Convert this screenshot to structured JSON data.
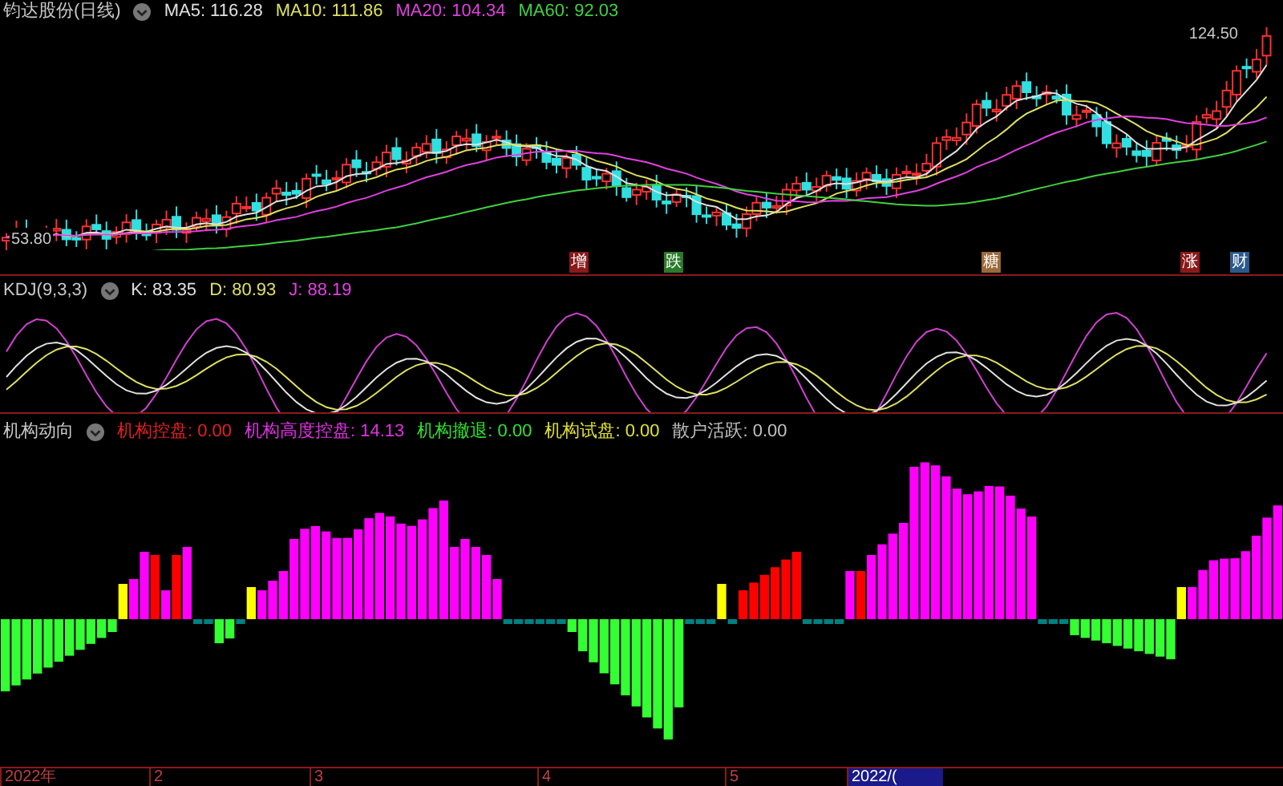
{
  "price_panel": {
    "title": "钧达股份(日线)",
    "indicators": [
      {
        "text": "MA5: 116.28",
        "color": "#e0e0e0"
      },
      {
        "text": "MA10: 111.86",
        "color": "#e0e060"
      },
      {
        "text": "MA20: 104.34",
        "color": "#e040e0"
      },
      {
        "text": "MA60: 92.03",
        "color": "#40d040"
      }
    ],
    "high_label": "124.50",
    "low_label": "53.80",
    "events": [
      {
        "label": "增",
        "color": "#8a1a1a"
      },
      {
        "label": "跌",
        "color": "#2a7a2a"
      },
      {
        "label": "糖",
        "color": "#9a6a3a"
      },
      {
        "label": "涨",
        "color": "#8a1a1a"
      },
      {
        "label": "财",
        "color": "#2a5a8a"
      }
    ]
  },
  "kdj_panel": {
    "title": "KDJ(9,3,3)",
    "indicators": [
      {
        "text": "K: 83.35",
        "color": "#e0e0e0"
      },
      {
        "text": "D: 80.93",
        "color": "#e0e060"
      },
      {
        "text": "J: 88.19",
        "color": "#e040e0"
      }
    ]
  },
  "flow_panel": {
    "title": "机构动向",
    "indicators": [
      {
        "text": "机构控盘: 0.00",
        "color": "#e02020"
      },
      {
        "text": "机构高度控盘: 14.13",
        "color": "#e030e0"
      },
      {
        "text": "机构撤退: 0.00",
        "color": "#30e030"
      },
      {
        "text": "机构试盘: 0.00",
        "color": "#e0e030"
      },
      {
        "text": "散户活跃: 0.00",
        "color": "#c0c0c0"
      }
    ]
  },
  "time_axis": [
    {
      "label": "2022年",
      "selected": false
    },
    {
      "label": "2",
      "selected": false
    },
    {
      "label": "3",
      "selected": false
    },
    {
      "label": "4",
      "selected": false
    },
    {
      "label": "5",
      "selected": false
    },
    {
      "label": "2022/(",
      "selected": true
    }
  ]
}
